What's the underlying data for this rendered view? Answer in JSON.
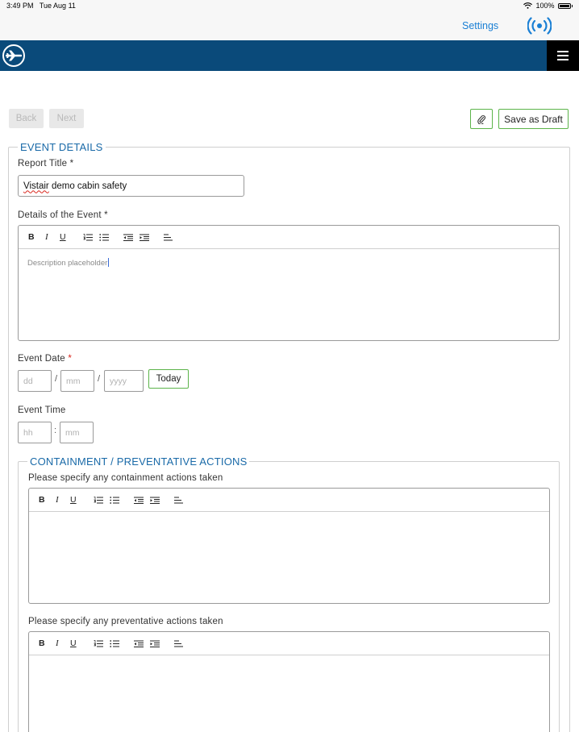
{
  "status_bar": {
    "time": "3:49 PM",
    "date": "Tue Aug 11",
    "battery": "100%"
  },
  "nav": {
    "settings_label": "Settings"
  },
  "toolbar": {
    "back_label": "Back",
    "next_label": "Next",
    "save_draft_label": "Save as Draft"
  },
  "event_details": {
    "legend": "EVENT DETAILS",
    "report_title_label": "Report Title *",
    "report_title_value_misspelled": "Vistair",
    "report_title_value_rest": " demo cabin safety",
    "details_label": "Details of the Event *",
    "details_placeholder": "Description placeholder",
    "event_date_label": "Event Date",
    "event_date_required": "*",
    "date_placeholders": {
      "day": "dd",
      "month": "mm",
      "year": "yyyy"
    },
    "date_separator": "/",
    "today_label": "Today",
    "event_time_label": "Event Time",
    "time_placeholders": {
      "hour": "hh",
      "minute": "mm"
    },
    "time_separator": ":"
  },
  "containment": {
    "legend": "CONTAINMENT / PREVENTATIVE ACTIONS",
    "containment_label": "Please specify any containment actions taken",
    "preventative_label": "Please specify any preventative actions taken"
  },
  "editor_toolbar": {
    "bold": "B",
    "italic": "I",
    "underline": "U"
  },
  "colors": {
    "brand": "#0a4a7a",
    "accent_green": "#5cb44a",
    "link_blue": "#1a7fd4",
    "legend_blue": "#1a6aa8",
    "required_red": "#d9251c"
  },
  "icons": [
    "wifi-icon",
    "battery-icon",
    "broadcast-signal-icon",
    "airplane-logo-icon",
    "hamburger-menu-icon",
    "paperclip-icon",
    "ordered-list-icon",
    "bullet-list-icon",
    "outdent-icon",
    "indent-icon",
    "align-left-icon"
  ]
}
